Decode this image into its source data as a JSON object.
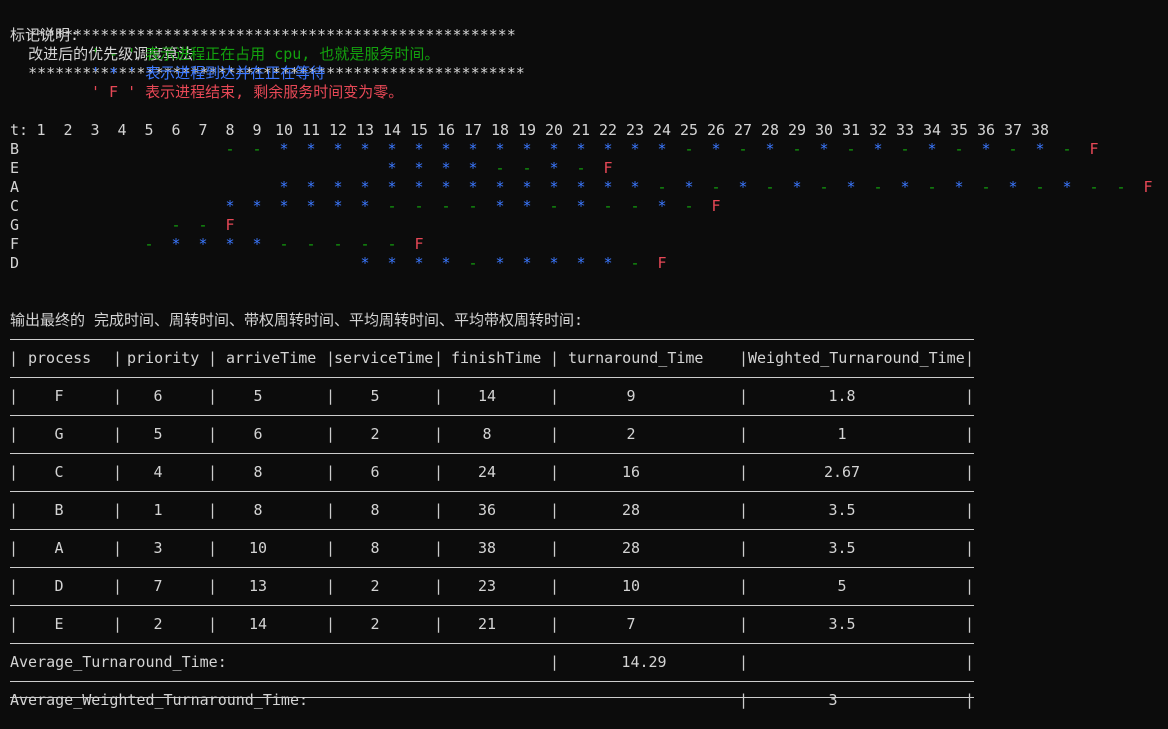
{
  "title": {
    "left_stars": "******************************************************",
    "text": "改进后的优先级调度算法",
    "right_stars": "*******************************************************"
  },
  "legend": {
    "heading": "标记说明:",
    "items": [
      {
        "text": "' - ' 表示进程正在占用 cpu, 也就是服务时间。",
        "color": "#13a10e"
      },
      {
        "text": "' * ' 表示进程到达并在正在等待",
        "color": "#3b78ff"
      },
      {
        "text": "' F ' 表示进程结束, 剩余服务时间变为零。",
        "color": "#e74856"
      }
    ]
  },
  "gantt": {
    "t_label": "t:",
    "ticks": [
      "1",
      "2",
      "3",
      "4",
      "5",
      "6",
      "7",
      "8",
      "9",
      "10",
      "11",
      "12",
      "13",
      "14",
      "15",
      "16",
      "17",
      "18",
      "19",
      "20",
      "21",
      "22",
      "23",
      "24",
      "25",
      "26",
      "27",
      "28",
      "29",
      "30",
      "31",
      "32",
      "33",
      "34",
      "35",
      "36",
      "37",
      "38"
    ],
    "rows": [
      {
        "name": "B",
        "start": 8,
        "marks": "--***************-*-*-*-*-*-*-*-F"
      },
      {
        "name": "E",
        "start": 14,
        "marks": "****--*-F"
      },
      {
        "name": "A",
        "start": 10,
        "marks": "**************-*-*-*-*-*-*-*-*--F"
      },
      {
        "name": "C",
        "start": 8,
        "marks": "******----**-*--*-F"
      },
      {
        "name": "G",
        "start": 6,
        "marks": "--F"
      },
      {
        "name": "F",
        "start": 5,
        "marks": "-****-----F"
      },
      {
        "name": "D",
        "start": 13,
        "marks": "****-*****-F"
      }
    ],
    "colors": {
      "dash": "#13a10e",
      "star": "#3b78ff",
      "finish": "#e74856"
    }
  },
  "output_heading": "输出最终的 完成时间、周转时间、带权周转时间、平均周转时间、平均带权周转时间:",
  "table": {
    "headers": [
      "process",
      "priority",
      "arriveTime",
      "serviceTime",
      "finishTime",
      "turnaround_Time",
      "Weighted_Turnaround_Time"
    ],
    "rows": [
      [
        "F",
        "6",
        "5",
        "5",
        "14",
        "9",
        "1.8"
      ],
      [
        "G",
        "5",
        "6",
        "2",
        "8",
        "2",
        "1"
      ],
      [
        "C",
        "4",
        "8",
        "6",
        "24",
        "16",
        "2.67"
      ],
      [
        "B",
        "1",
        "8",
        "8",
        "36",
        "28",
        "3.5"
      ],
      [
        "A",
        "3",
        "10",
        "8",
        "38",
        "28",
        "3.5"
      ],
      [
        "D",
        "7",
        "13",
        "2",
        "23",
        "10",
        "5"
      ],
      [
        "E",
        "2",
        "14",
        "2",
        "21",
        "7",
        "3.5"
      ]
    ],
    "avg_turnaround_label": "Average_Turnaround_Time:",
    "avg_turnaround_value": "14.29",
    "avg_weighted_label": "Average_Weighted_Turnaround_Time:",
    "avg_weighted_value": "3"
  }
}
